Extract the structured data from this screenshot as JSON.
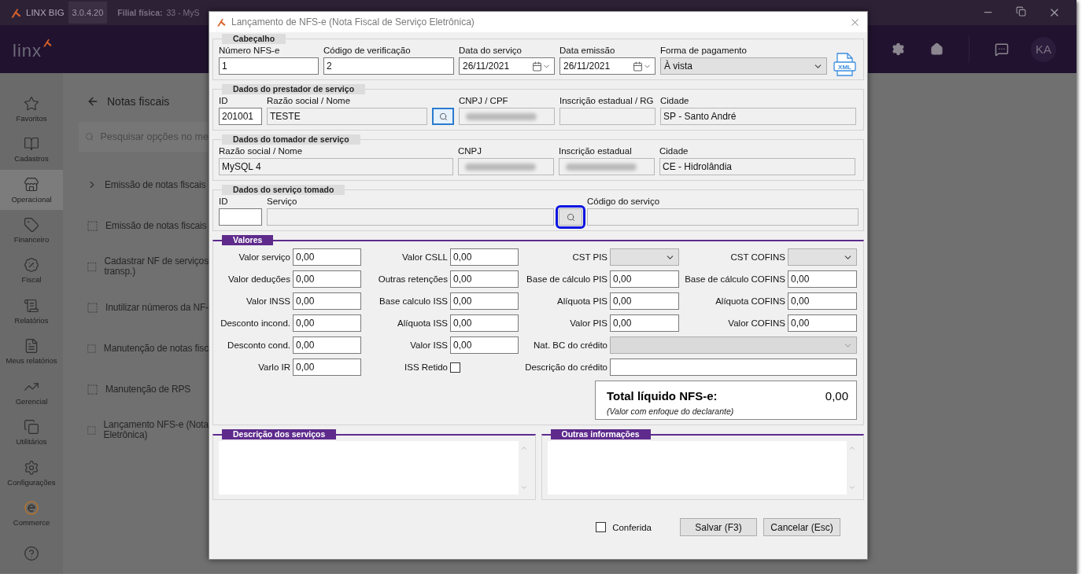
{
  "app": {
    "title": "LINX BIG",
    "version": "3.0.4.20",
    "branch_label": "Filial física:",
    "branch_value": "33 - MyS",
    "logo": "linx",
    "avatar": "KA"
  },
  "sidebar": {
    "items": [
      {
        "label": "Favoritos",
        "selected": false
      },
      {
        "label": "Cadastros",
        "selected": false
      },
      {
        "label": "Operacional",
        "selected": true
      },
      {
        "label": "Financeiro",
        "selected": false
      },
      {
        "label": "Fiscal",
        "selected": false
      },
      {
        "label": "Relatórios",
        "selected": false
      },
      {
        "label": "Meus relatórios",
        "selected": false
      },
      {
        "label": "Gerencial",
        "selected": false
      },
      {
        "label": "Utilitários",
        "selected": false
      },
      {
        "label": "Configurações",
        "selected": false
      },
      {
        "label": "Commerce",
        "selected": false
      },
      {
        "selected": false
      }
    ]
  },
  "page": {
    "title": "Notas fiscais",
    "search": {
      "placeholder": "Pesquisar opções no me"
    },
    "items": [
      {
        "kind": "group",
        "lines": [
          "Emissão de notas fiscais"
        ]
      },
      {
        "kind": "option",
        "lines": [
          "Emissão de notas fiscais"
        ]
      },
      {
        "kind": "option",
        "lines": [
          "Cadastrar NF de serviços",
          "transp.)"
        ]
      },
      {
        "kind": "option",
        "lines": [
          "Inutilizar números da NF-"
        ]
      },
      {
        "kind": "option",
        "lines": [
          "Manutenção de notas fisc"
        ]
      },
      {
        "kind": "option",
        "lines": [
          "Manutenção de RPS"
        ]
      },
      {
        "kind": "option",
        "lines": [
          "Lançamento NFS-e (Nota",
          "Eletrônica)"
        ]
      }
    ]
  },
  "dialog": {
    "title": "Lançamento de NFS-e (Nota Fiscal de Serviço Eletrônica)",
    "sections": [
      {
        "legend": "Cabeçalho",
        "xml_label": "XML",
        "fields": [
          {
            "kind": "input",
            "label": "Número NFS-e",
            "value": "1"
          },
          {
            "kind": "input",
            "label": "Código de verificação",
            "value": "2"
          },
          {
            "kind": "date",
            "label": "Data do serviço",
            "value": "26/11/2021"
          },
          {
            "kind": "date",
            "label": "Data emissão",
            "value": "26/11/2021"
          },
          {
            "kind": "select",
            "label": "Forma de pagamento",
            "value": "À vista"
          }
        ]
      },
      {
        "legend": "Dados do prestador de serviço",
        "fields": [
          {
            "kind": "input",
            "label": "ID",
            "value": "201001"
          },
          {
            "kind": "readonly",
            "label": "Razão social / Nome",
            "value": "TESTE"
          },
          {
            "kind": "lookup",
            "focused": true,
            "marked": false
          },
          {
            "kind": "redacted",
            "label": "CNPJ / CPF"
          },
          {
            "kind": "readonly",
            "label": "Inscrição estadual / RG"
          },
          {
            "kind": "readonly",
            "label": "Cidade",
            "value": "SP - Santo André"
          }
        ]
      },
      {
        "legend": "Dados do tomador de serviço",
        "fields": [
          {
            "kind": "readonly",
            "label": "Razão social / Nome",
            "value": "MySQL 4"
          },
          {
            "kind": "redacted",
            "label": "CNPJ"
          },
          {
            "kind": "redacted",
            "label": "Inscrição estadual"
          },
          {
            "kind": "readonly",
            "label": "Cidade",
            "value": "CE - Hidrolândia"
          }
        ]
      },
      {
        "legend": "Dados do serviço tomado",
        "fields": [
          {
            "kind": "input",
            "label": "ID"
          },
          {
            "kind": "readonly",
            "label": "Serviço"
          },
          {
            "kind": "lookup",
            "focused": false,
            "marked": true
          },
          {
            "kind": "readonly",
            "label": "Código do serviço"
          }
        ]
      }
    ],
    "valores": {
      "legend": "Valores",
      "columns": [
        [
          {
            "kind": "input",
            "label": "Valor serviço",
            "value": "0,00"
          },
          {
            "kind": "input",
            "label": "Valor deduções",
            "value": "0,00"
          },
          {
            "kind": "input",
            "label": "Valor INSS",
            "value": "0,00"
          },
          {
            "kind": "input",
            "label": "Desconto incond.",
            "value": "0,00"
          },
          {
            "kind": "input",
            "label": "Desconto cond.",
            "value": "0,00"
          },
          {
            "kind": "input",
            "label": "Varlo IR",
            "value": "0,00"
          }
        ],
        [
          {
            "kind": "input",
            "label": "Valor CSLL",
            "value": "0,00"
          },
          {
            "kind": "input",
            "label": "Outras retenções",
            "value": "0,00"
          },
          {
            "kind": "input",
            "label": "Base calculo ISS",
            "value": "0,00"
          },
          {
            "kind": "input",
            "label": "Alíquota ISS",
            "value": "0,00"
          },
          {
            "kind": "input",
            "label": "Valor ISS",
            "value": "0,00"
          },
          {
            "kind": "checkbox",
            "label": "ISS Retido",
            "checked": false
          }
        ],
        [
          {
            "kind": "select",
            "label": "CST PIS",
            "disabled": false
          },
          {
            "kind": "input",
            "label": "Base de cálculo PIS",
            "value": "0,00"
          },
          {
            "kind": "input",
            "label": "Alíquota PIS",
            "value": "0,00"
          },
          {
            "kind": "input",
            "label": "Valor PIS",
            "value": "0,00"
          },
          {
            "kind": "select",
            "label": "Nat. BC do crédito",
            "disabled": true
          },
          {
            "kind": "input",
            "label": "Descrição do crédito"
          }
        ],
        [
          {
            "kind": "select",
            "label": "CST COFINS",
            "disabled": false
          },
          {
            "kind": "input",
            "label": "Base de cálculo COFINS",
            "value": "0,00"
          },
          {
            "kind": "input",
            "label": "Alíquota COFINS",
            "value": "0,00"
          },
          {
            "kind": "input",
            "label": "Valor COFINS",
            "value": "0,00"
          }
        ]
      ],
      "total": {
        "label": "Total líquido NFS-e:",
        "value": "0,00",
        "note": "(Valor com enfoque do declarante)"
      }
    },
    "notes": [
      {
        "legend": "Descrição dos serviços"
      },
      {
        "legend": "Outras informações"
      }
    ],
    "footer": {
      "check": {
        "label": "Conferida",
        "checked": false
      },
      "buttons": [
        {
          "label": "Salvar (F3)"
        },
        {
          "label": "Cancelar (Esc)"
        }
      ]
    }
  }
}
